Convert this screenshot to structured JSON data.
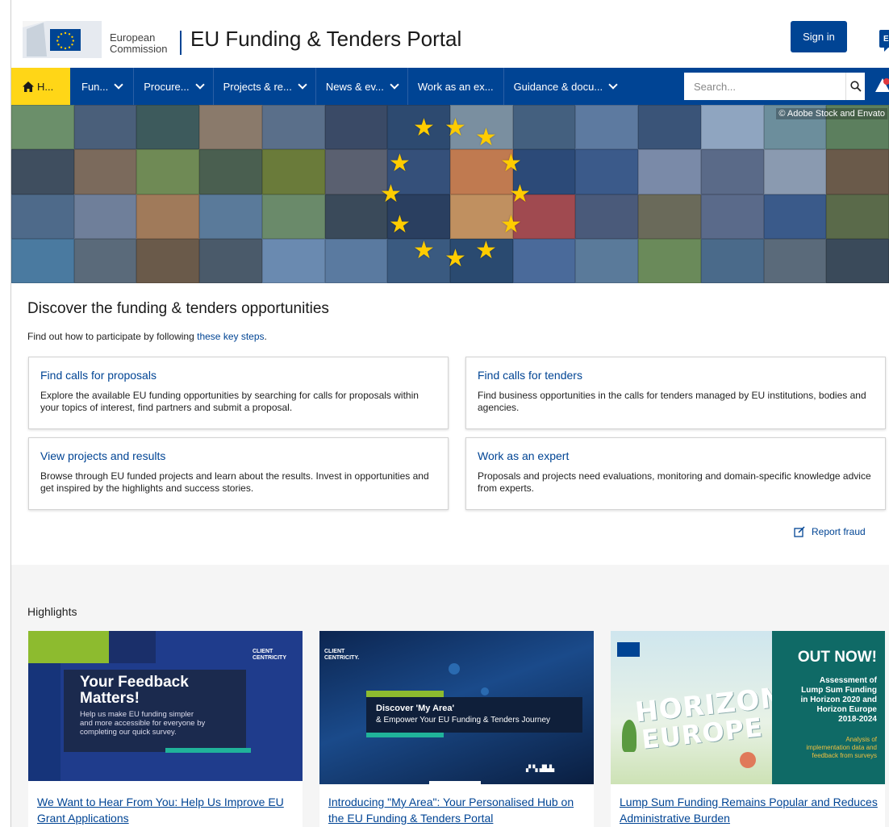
{
  "header": {
    "ec_line1": "European",
    "ec_line2": "Commission",
    "portal_title": "EU Funding & Tenders Portal",
    "signin_label": "Sign in",
    "language": "EN"
  },
  "nav": {
    "home_label": "H...",
    "items": [
      {
        "label": "Fun..."
      },
      {
        "label": "Procure..."
      },
      {
        "label": "Projects & re..."
      },
      {
        "label": "News & ev..."
      },
      {
        "label": "Work as an ex..."
      },
      {
        "label": "Guidance & docu..."
      }
    ],
    "search_placeholder": "Search..."
  },
  "hero": {
    "credit": "© Adobe Stock and Envato"
  },
  "discover": {
    "title": "Discover the funding & tenders opportunities",
    "intro_text": "Find out how to participate by following ",
    "intro_link": "these key steps",
    "intro_end": ".",
    "cards": [
      {
        "title": "Find calls for proposals",
        "desc": "Explore the available EU funding opportunities by searching for calls for proposals within your topics of interest, find partners and submit a proposal."
      },
      {
        "title": "Find calls for tenders",
        "desc": "Find business opportunities in the calls for tenders managed by EU institutions, bodies and agencies."
      },
      {
        "title": "View projects and results",
        "desc": "Browse through EU funded projects and learn about the results. Invest in opportunities and get inspired by the highlights and success stories."
      },
      {
        "title": "Work as an expert",
        "desc": "Proposals and projects need evaluations, monitoring and domain-specific knowledge advice from experts."
      }
    ],
    "report_fraud": "Report fraud"
  },
  "highlights": {
    "title": "Highlights",
    "items": [
      {
        "link": "We Want to Hear From You: Help Us Improve EU Grant Applications",
        "img_tag": "CLIENT CENTRICITY",
        "img_heading_1": "Your Feedback",
        "img_heading_2": "Matters!",
        "img_sub_1": "Help us make EU funding simpler",
        "img_sub_2": "and more accessible for everyone by",
        "img_sub_3": "completing our quick survey."
      },
      {
        "link": "Introducing \"My Area\": Your Personalised Hub on the EU Funding & Tenders Portal",
        "img_tag": "CLIENT CENTRICITY.",
        "img_heading": "Discover 'My Area'",
        "img_sub": "& Empower Your EU Funding & Tenders Journey"
      },
      {
        "link": "Lump Sum Funding Remains Popular and Reduces Administrative Burden",
        "img_word1": "HORIZON",
        "img_word2": "EUROPE",
        "img_outnow": "OUT NOW!",
        "img_l1": "Assessment of",
        "img_l2": "Lump Sum Funding",
        "img_l3": "in Horizon 2020 and",
        "img_l4": "Horizon Europe",
        "img_l5": "2018-2024",
        "img_s1": "Analysis of",
        "img_s2": "implementation data and",
        "img_s3": "feedback from surveys"
      }
    ]
  },
  "colors": {
    "brand_blue": "#004494",
    "home_yellow": "#ffd617",
    "link_blue": "#004494"
  }
}
